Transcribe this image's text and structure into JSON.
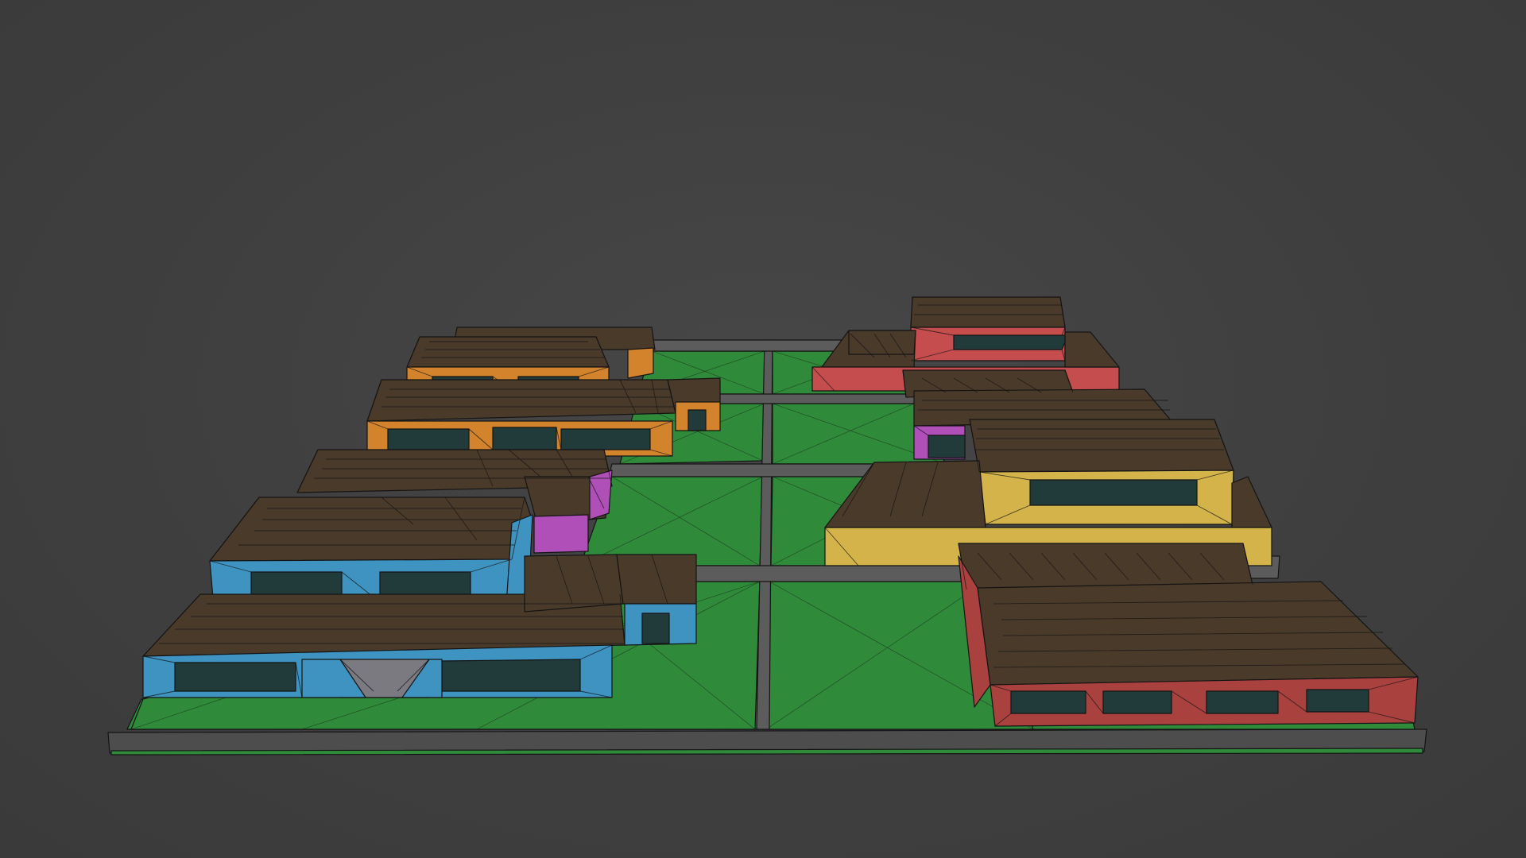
{
  "viewport": {
    "background": "#404040",
    "render_mode": "solid-wireframe"
  },
  "scene": {
    "ground_color": "#2f8a3a",
    "road_color": "#5c5c5c",
    "roof_color": "#4a3a2a",
    "window_color": "#213b3b",
    "lots": 8,
    "houses": [
      {
        "name": "house-orange-upper",
        "wall_color": "#d2832b"
      },
      {
        "name": "house-orange-lower",
        "wall_color": "#d2832b"
      },
      {
        "name": "house-purple",
        "wall_color": "#b04fb8"
      },
      {
        "name": "house-blue",
        "wall_color": "#3e93c1"
      },
      {
        "name": "house-red-back",
        "wall_color": "#c54d4d"
      },
      {
        "name": "house-purple-right",
        "wall_color": "#b04fb8"
      },
      {
        "name": "house-yellow",
        "wall_color": "#d4b44a"
      },
      {
        "name": "house-red-front",
        "wall_color": "#a9413e"
      }
    ]
  }
}
